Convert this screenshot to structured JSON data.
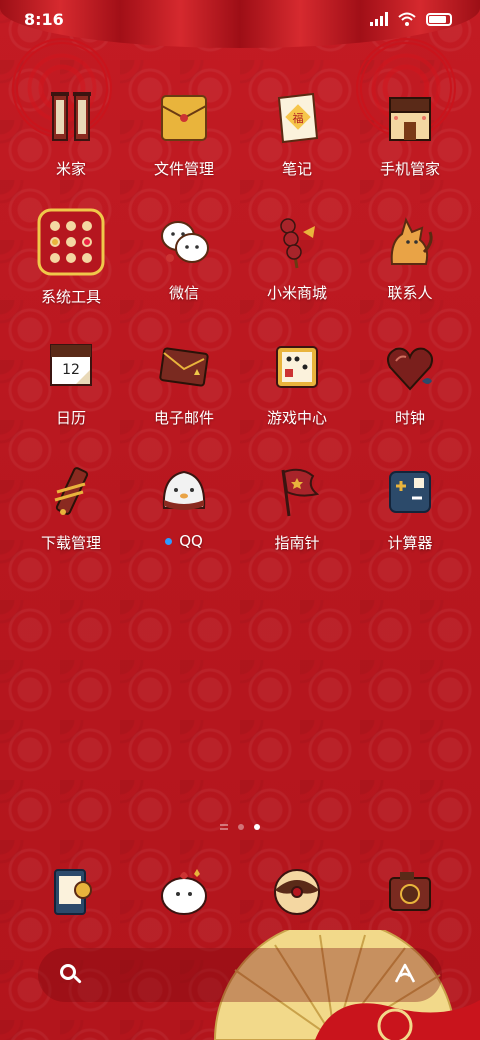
{
  "status": {
    "time": "8:16"
  },
  "apps": [
    {
      "label": "米家",
      "icon": "scroll-couplet-icon"
    },
    {
      "label": "文件管理",
      "icon": "gold-envelope-icon"
    },
    {
      "label": "笔记",
      "icon": "fu-paper-icon"
    },
    {
      "label": "手机管家",
      "icon": "chocolate-house-icon"
    },
    {
      "label": "系统工具",
      "icon": "system-tools-folder-icon"
    },
    {
      "label": "微信",
      "icon": "chat-bubbles-icon"
    },
    {
      "label": "小米商城",
      "icon": "candied-haws-icon"
    },
    {
      "label": "联系人",
      "icon": "tiger-icon"
    },
    {
      "label": "日历",
      "icon": "calendar-icon",
      "date": "12"
    },
    {
      "label": "电子邮件",
      "icon": "envelope-icon"
    },
    {
      "label": "游戏中心",
      "icon": "game-board-icon"
    },
    {
      "label": "时钟",
      "icon": "heart-clock-icon"
    },
    {
      "label": "下载管理",
      "icon": "firecracker-icon"
    },
    {
      "label": "QQ",
      "icon": "penguin-icon",
      "notification_dot": true
    },
    {
      "label": "指南针",
      "icon": "flag-icon"
    },
    {
      "label": "计算器",
      "icon": "calculator-icon"
    }
  ],
  "dock": [
    {
      "icon": "phone-card-icon"
    },
    {
      "icon": "cute-bubble-icon"
    },
    {
      "icon": "donut-icon"
    },
    {
      "icon": "camera-icon"
    }
  ],
  "page_indicator": {
    "pages": 3,
    "current": 3
  }
}
